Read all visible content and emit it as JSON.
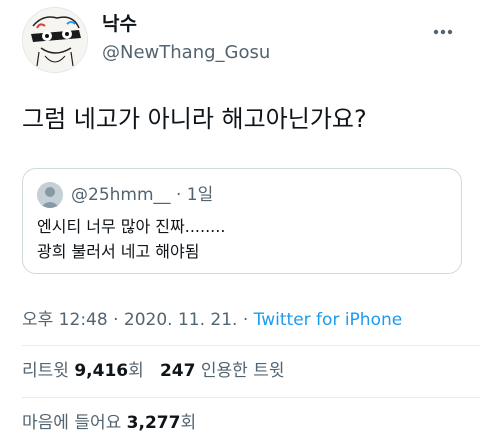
{
  "author": {
    "name": "낙수",
    "handle": "@NewThang_Gosu",
    "avatar_icon": "sketch-avatar-icon"
  },
  "tweet": {
    "text": "그럼 네고가 아니라 해고아닌가요?"
  },
  "quote": {
    "handle": "@25hmm__",
    "separator": "·",
    "time": "1일",
    "line1": "엔시티 너무 많아 진짜........",
    "line2": "광희 불러서 네고 해야됨"
  },
  "meta": {
    "time": "오후 12:48",
    "sep1": "·",
    "date": "2020. 11. 21.",
    "sep2": "·",
    "source": "Twitter for iPhone"
  },
  "stats": {
    "retweet_label": "리트윗",
    "retweet_count": "9,416",
    "retweet_unit": "회",
    "quote_count": "247",
    "quote_label": "인용한 트윗"
  },
  "likes": {
    "label": "마음에 들어요",
    "count": "3,277",
    "unit": "회"
  },
  "colors": {
    "link": "#1d9bf0",
    "secondary_text": "#536471",
    "border": "#cfd9de"
  }
}
